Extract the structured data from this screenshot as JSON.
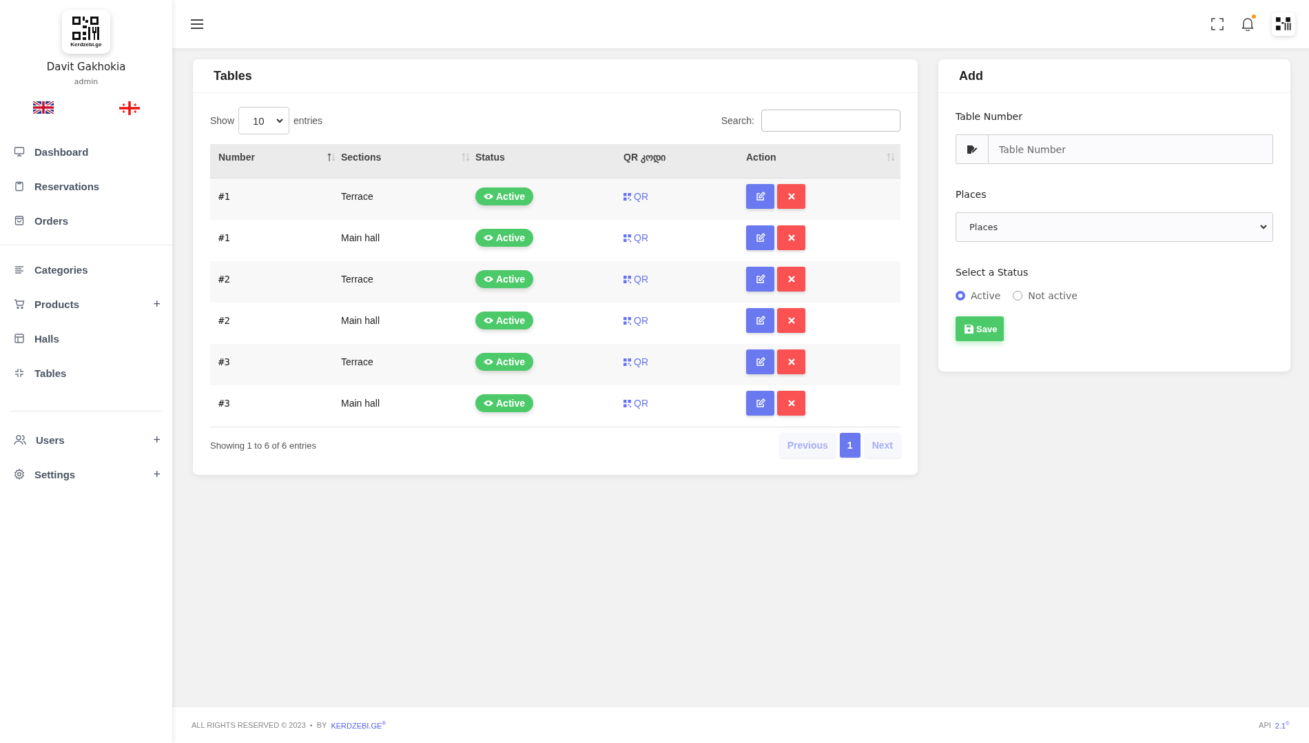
{
  "sidebar": {
    "logo_text": "Kerdzebi.ge",
    "user_name": "Davit Gakhokia",
    "user_role": "admin",
    "groups": [
      [
        {
          "label": "Dashboard"
        },
        {
          "label": "Reservations"
        },
        {
          "label": "Orders"
        }
      ],
      [
        {
          "label": "Categories"
        },
        {
          "label": "Products",
          "toggle": "+"
        },
        {
          "label": "Halls"
        },
        {
          "label": "Tables"
        }
      ],
      [
        {
          "label": "Users",
          "toggle": "+"
        },
        {
          "label": "Settings",
          "toggle": "+"
        }
      ]
    ]
  },
  "topbar": {
    "notification": true
  },
  "tables_card": {
    "title": "Tables",
    "show_label": "Show",
    "page_size": "10",
    "entries_label": "entries",
    "search_label": "Search:",
    "columns": [
      {
        "label": "Number",
        "sorted": true
      },
      {
        "label": "Sections",
        "sorted": false
      },
      {
        "label": "Status"
      },
      {
        "label": "QR კოდი"
      },
      {
        "label": "Action",
        "sorted": false
      }
    ],
    "rows": [
      {
        "number": "#1",
        "section": "Terrace",
        "status": "Active",
        "qr": "QR"
      },
      {
        "number": "#1",
        "section": "Main hall",
        "status": "Active",
        "qr": "QR"
      },
      {
        "number": "#2",
        "section": "Terrace",
        "status": "Active",
        "qr": "QR"
      },
      {
        "number": "#2",
        "section": "Main hall",
        "status": "Active",
        "qr": "QR"
      },
      {
        "number": "#3",
        "section": "Terrace",
        "status": "Active",
        "qr": "QR"
      },
      {
        "number": "#3",
        "section": "Main hall",
        "status": "Active",
        "qr": "QR"
      }
    ],
    "info": "Showing 1 to 6 of 6 entries",
    "pagination": {
      "previous": {
        "label": "Previous",
        "disabled": true
      },
      "pages": [
        {
          "label": "1",
          "selected": true
        }
      ],
      "next": {
        "label": "Next",
        "disabled": true
      }
    }
  },
  "add_card": {
    "title": "Add",
    "table_number_label": "Table Number",
    "table_number_placeholder": "Table Number",
    "places_label": "Places",
    "places_value": "Places",
    "status_label": "Select a Status",
    "status_options": [
      {
        "label": "Active",
        "selected": true
      },
      {
        "label": "Not active",
        "selected": false
      }
    ],
    "save_label": "Save"
  },
  "footer": {
    "copyright": "ALL RIGHTS RESERVED © 2023",
    "separator": "•",
    "by": "BY",
    "link": "KERDZEBI.GE$^{®}$",
    "api_label": "API",
    "api_version": "2.1$^{©}$"
  }
}
